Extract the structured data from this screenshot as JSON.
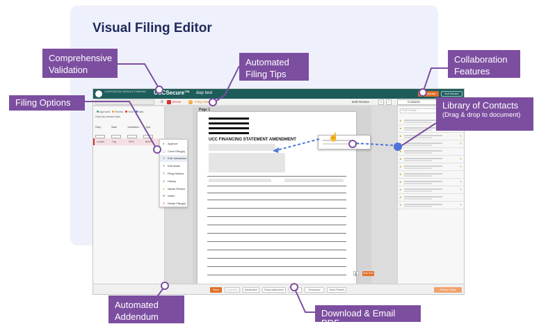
{
  "page_title": "Visual Filing Editor",
  "app": {
    "brand": "UCCSecure™",
    "document_title": "dup test",
    "logo_text": "CORPORATION SERVICE COMPANY",
    "collaborate_label": "Collaborate",
    "exit_label": "Exit Wizard"
  },
  "toolbar": {
    "errors_label": "Errors",
    "tips_count": "0",
    "tips_label": "Filing Tips",
    "bulk_review_label": "Bulk Review",
    "zoom_in": "+",
    "zoom_out": "−",
    "contacts_label": "Contacts"
  },
  "left_pane": {
    "statuses": [
      {
        "label": "Approved",
        "color": "#3aa655"
      },
      {
        "label": "Review",
        "color": "#f0a02a"
      },
      {
        "label": "Hold",
        "color": "#d9322e"
      },
      {
        "label": "Valid",
        "color": "#3b6fc8"
      }
    ],
    "unread_label": "Only has unread notes",
    "filters": [
      "Party",
      "State",
      "Jurisdiction",
      "Type"
    ],
    "party_row": [
      "Lender",
      "Org",
      "SOS",
      "BNHV"
    ]
  },
  "context_menu": [
    {
      "label": "Approve",
      "icon": "check-icon"
    },
    {
      "label": "Clone Filing(s)",
      "icon": "copy-icon"
    },
    {
      "label": "Edit Jurisdiction",
      "icon": "pencil-icon"
    },
    {
      "label": "Edit Name",
      "icon": "pencil-icon"
    },
    {
      "label": "Filing Method",
      "icon": "pencil-icon"
    },
    {
      "label": "History",
      "icon": "clock-icon"
    },
    {
      "label": "Needs Review",
      "icon": "dot-icon"
    },
    {
      "label": "Notes",
      "icon": "note-icon"
    },
    {
      "label": "Delete Filing(s)",
      "icon": "x-icon"
    }
  ],
  "document": {
    "page_label": "Page 1",
    "form_title": "UCC FINANCING STATEMENT AMENDMENT",
    "start_label": "Start Here"
  },
  "right_pane": {
    "find_placeholder": "Find Contact..."
  },
  "bottom_bar": {
    "buttons": [
      "Save",
      "Approve",
      "Addendum",
      "Party Addendum",
      "Print",
      "Download",
      "Send Packet"
    ],
    "review_label": "Review Order"
  },
  "callouts": {
    "validation": "Comprehensive Validation",
    "tips": "Automated Filing Tips",
    "collab": "Collaboration Features",
    "filing_options": "Filing Options",
    "contacts_title": "Library of Contacts",
    "contacts_sub": "(Drag & drop to document)",
    "addendum": "Automated Addendum Creation",
    "download": "Download & Email PDF"
  },
  "colors": {
    "callout": "#7c4ea0",
    "header": "#1e5c5b",
    "accent": "#e0712a",
    "error": "#d9322e",
    "connector": "#4d74d9"
  }
}
